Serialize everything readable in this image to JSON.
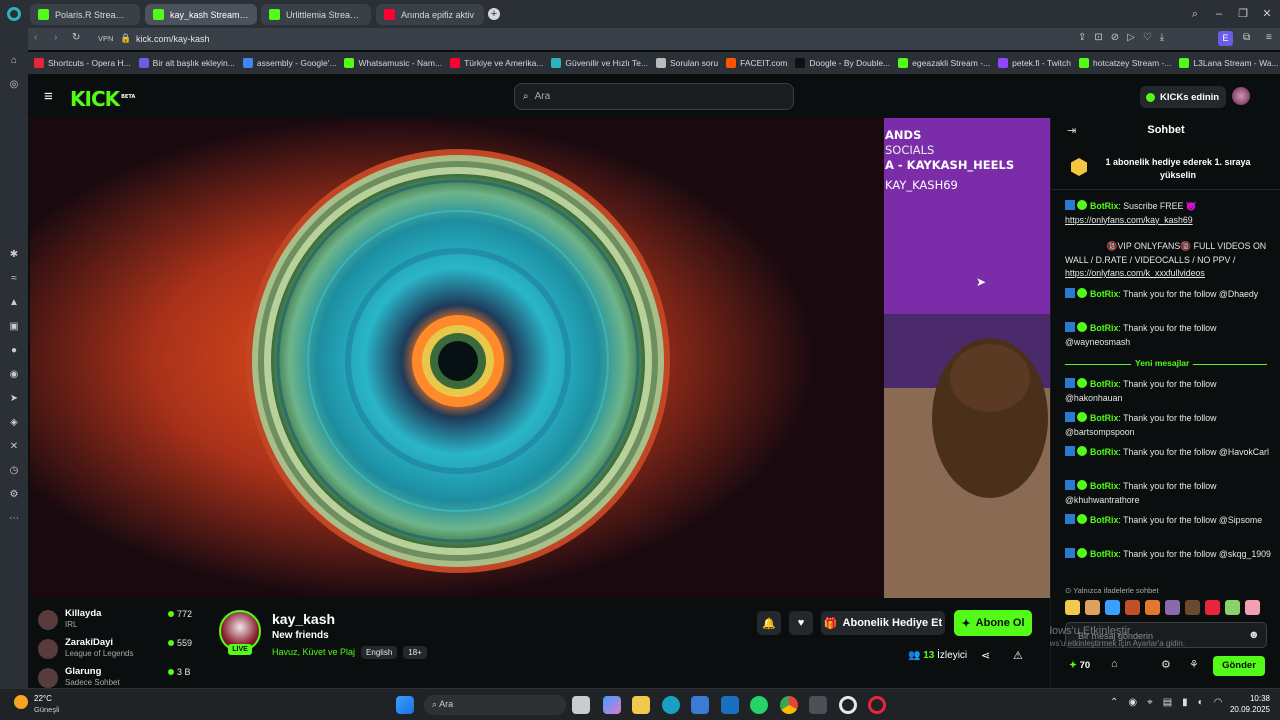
{
  "browser": {
    "tabs": [
      {
        "label": "Polaris.R Stream - Watch"
      },
      {
        "label": "kay_kash Stream - Watch"
      },
      {
        "label": "Urlittlemia Stream - Wat"
      },
      {
        "label": "Anında epifiz aktiv"
      }
    ],
    "url_prefix": "VPN",
    "url": "kick.com/kay-kash",
    "bookmarks": [
      {
        "label": "Shortcuts - Opera H...",
        "color": "#e8253a"
      },
      {
        "label": "Bir alt başlık ekleyin...",
        "color": "#6c5ce7"
      },
      {
        "label": "assembly - Google'...",
        "color": "#4285f4"
      },
      {
        "label": "Whatsamusic - Nam...",
        "color": "#53fc18"
      },
      {
        "label": "Türkiye ve Amerika...",
        "color": "#ff0033"
      },
      {
        "label": "Güvenilir ve Hızlı Te...",
        "color": "#2bb3c0"
      },
      {
        "label": "Sorulan soru",
        "color": "#bbbbbb"
      },
      {
        "label": "FACEIT.com",
        "color": "#ff5500"
      },
      {
        "label": "Doogle - By Double...",
        "color": "#111111"
      },
      {
        "label": "egeazakli Stream -...",
        "color": "#53fc18"
      },
      {
        "label": "petek.fi - Twitch",
        "color": "#9146ff"
      },
      {
        "label": "hotcatzey Stream -...",
        "color": "#53fc18"
      },
      {
        "label": "L3Lana Stream - Wa...",
        "color": "#53fc18"
      }
    ]
  },
  "kick": {
    "logo": "KICK",
    "logo_beta": "BETA",
    "search_placeholder": "Ara",
    "kicks_button": "KICKs edinin"
  },
  "overlay": {
    "line1": "ANDS",
    "line2": "SOCIALS",
    "line3": "A - KAYKASH_HEELS",
    "line4": "KAY_KASH69"
  },
  "chat": {
    "title": "Sohbet",
    "pinned": "1 abonelik hediye ederek 1. sıraya yükselin",
    "messages": [
      {
        "user": "BotRix",
        "text": ": Suscribe FREE 😈",
        "link": "https://onlyfans.com/kay_kash69"
      },
      {
        "text": "                 🔞VIP ONLYFANS🔞 FULL VIDEOS ON WALL / D.RATE / VIDEOCALLS / NO PPV / ",
        "link": "https://onlyfans.com/k_xxxfullvideos"
      },
      {
        "user": "BotRix",
        "text": ": Thank you for the follow @Dhaedy"
      },
      {
        "user": "BotRix",
        "text": ": Thank you for the follow @wayneosmash"
      }
    ],
    "new_messages_label": "Yeni mesajlar",
    "new_messages": [
      {
        "user": "BotRix",
        "text": ": Thank you for the follow @hakonhauan"
      },
      {
        "user": "BotRix",
        "text": ": Thank you for the follow @bartsompspoon"
      },
      {
        "user": "BotRix",
        "text": ": Thank you for the follow @HavokCarl"
      },
      {
        "user": "BotRix",
        "text": ": Thank you for the follow @khuhwantrathore"
      },
      {
        "user": "BotRix",
        "text": ": Thank you for the follow @Sipsome"
      },
      {
        "user": "BotRix",
        "text": ": Thank you for the follow @skqg_1909"
      }
    ],
    "emote_mode": "Yalnızca ifadelerle sohbet",
    "input_placeholder": "Bir mesaj gönderin",
    "kicks_count": "70",
    "send_label": "Gönder"
  },
  "channel": {
    "name": "kay_kash",
    "title": "New friends",
    "category": "Havuz, Küvet ve Plaj",
    "tags": [
      "English",
      "18+"
    ],
    "live_label": "LIVE",
    "viewers": "13",
    "viewers_label": "İzleyici",
    "gift_sub_label": "Abonelik Hediye Et",
    "subscribe_label": "Abone Ol"
  },
  "recommended": [
    {
      "name": "Killayda",
      "category": "IRL",
      "viewers": "772"
    },
    {
      "name": "ZarakiDayi",
      "category": "League of Legends",
      "viewers": "559"
    },
    {
      "name": "Glarung",
      "category": "Sadece Sohbet",
      "viewers": "3 B"
    }
  ],
  "windows": {
    "weather_temp": "22°C",
    "weather_desc": "Güneşli",
    "search": "Ara",
    "time": "10:38",
    "date": "20.09.2025",
    "activation_title": "Windows'u Etkinleştir",
    "activation_sub": "Windows'u etkinleştirmek için Ayarlar'a gidin."
  },
  "colors": {
    "kick_green": "#53fc18",
    "bg": "#0b0e0f",
    "panel": "#191d20"
  }
}
